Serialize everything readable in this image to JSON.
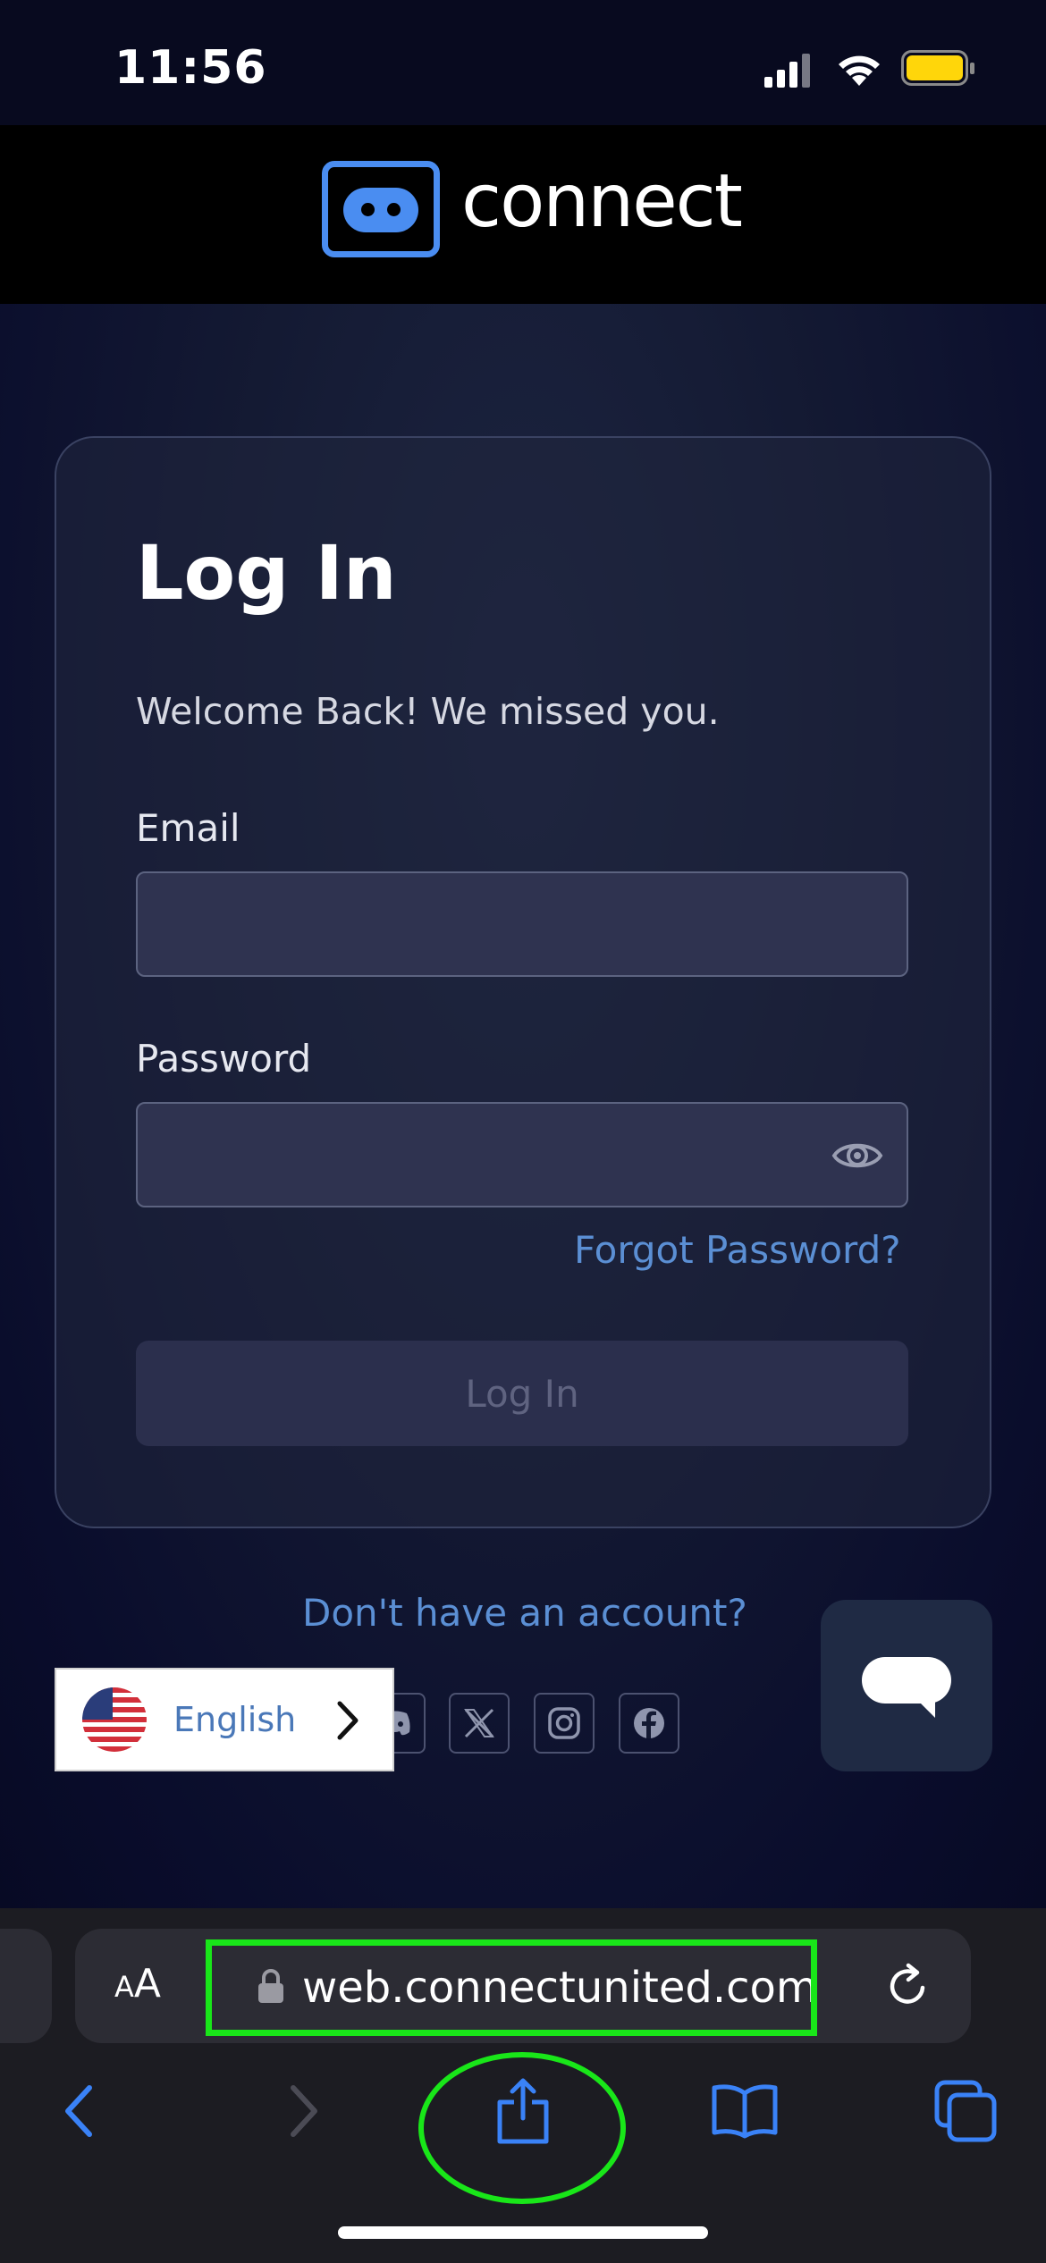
{
  "status_bar": {
    "time": "11:56",
    "icons": [
      "cellular-signal-icon",
      "wifi-icon",
      "battery-icon"
    ],
    "battery_color": "#ffd60a"
  },
  "header": {
    "logo_icon": "robot-face-icon",
    "logo_text": "connect",
    "logo_color": "#4a8df1"
  },
  "login": {
    "title": "Log In",
    "welcome": "Welcome Back! We missed you.",
    "email_label": "Email",
    "email_value": "",
    "password_label": "Password",
    "password_value": "",
    "password_toggle_icon": "eye-icon",
    "forgot_password": "Forgot Password?",
    "submit_label": "Log In"
  },
  "footer": {
    "signup_prompt": "Don't have an account?",
    "social_icons": [
      "discord-icon",
      "x-icon",
      "instagram-icon",
      "facebook-icon"
    ],
    "chat_icon": "chat-bubble-icon"
  },
  "language_selector": {
    "flag_icon": "us-flag-icon",
    "label": "English",
    "chevron_icon": "chevron-right-icon"
  },
  "browser": {
    "text_size_label_small": "A",
    "text_size_label_large": "A",
    "url": "web.connectunited.com",
    "lock_icon": "lock-icon",
    "reload_icon": "reload-icon",
    "toolbar": [
      "back-icon",
      "forward-icon",
      "share-icon",
      "bookmarks-icon",
      "tabs-icon"
    ],
    "accent_color": "#3a82f7",
    "annotation_color": "#19e619"
  }
}
